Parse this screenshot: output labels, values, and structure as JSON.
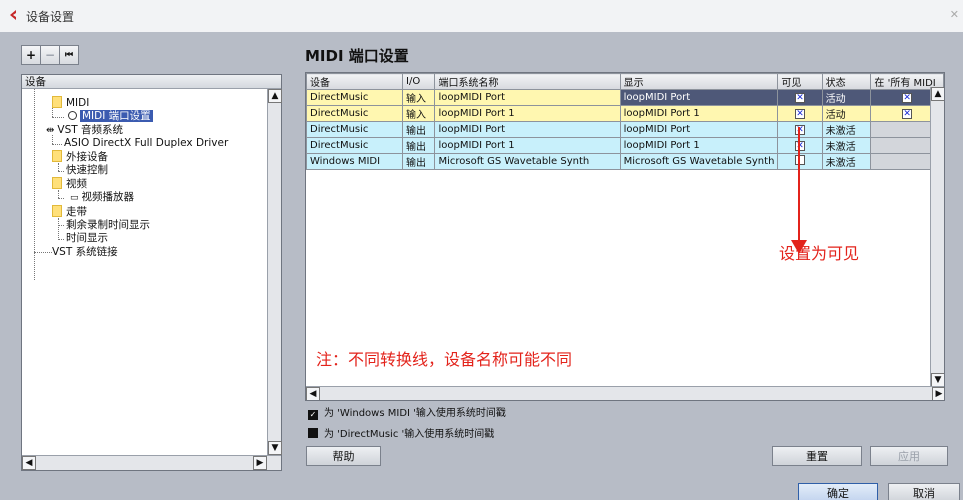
{
  "window": {
    "title": "设备设置"
  },
  "left_panel": {
    "toolbar": {
      "add": "+",
      "remove": "−",
      "reset": "⏮"
    },
    "tree_header": "设备",
    "tree_items": {
      "midi": "MIDI",
      "midi_port": "MIDI 端口设置",
      "vst_audio": "VST 音频系统",
      "asio": "ASIO DirectX Full Duplex Driver",
      "ext_devices": "外接设备",
      "quick_control": "快速控制",
      "video": "视频",
      "video_player": "视频播放器",
      "transport": "走带",
      "remaining_time": "剩余录制时间显示",
      "time_display": "时间显示",
      "vst_link": "VST 系统链接"
    }
  },
  "right_panel": {
    "title": "MIDI 端口设置",
    "columns": [
      "设备",
      "I/O",
      "端口系统名称",
      "显示",
      "可见",
      "状态",
      "在 '所有 MIDI"
    ],
    "rows": [
      {
        "device": "DirectMusic",
        "io": "输入",
        "port": "loopMIDI Port",
        "display": "loopMIDI Port",
        "visible": "x",
        "status": "活动",
        "all": "x"
      },
      {
        "device": "DirectMusic",
        "io": "输入",
        "port": "loopMIDI Port 1",
        "display": "loopMIDI Port 1",
        "visible": "x",
        "status": "活动",
        "all": "x"
      },
      {
        "device": "DirectMusic",
        "io": "输出",
        "port": "loopMIDI Port",
        "display": "loopMIDI Port",
        "visible": "x",
        "status": "未激活",
        "all": ""
      },
      {
        "device": "DirectMusic",
        "io": "输出",
        "port": "loopMIDI Port 1",
        "display": "loopMIDI Port 1",
        "visible": "x",
        "status": "未激活",
        "all": ""
      },
      {
        "device": "Windows MIDI",
        "io": "输出",
        "port": "Microsoft GS Wavetable Synth",
        "display": "Microsoft GS Wavetable Synth",
        "visible": "",
        "status": "未激活",
        "all": ""
      }
    ],
    "annotation_visible": "设置为可见",
    "annotation_note": "注：不同转换线，设备名称可能不同",
    "checkbox_windows": "为 'Windows MIDI '输入使用系统时间戳",
    "checkbox_directmusic": "为 'DirectMusic '输入使用系统时间戳",
    "help_button": "帮助",
    "reset_button": "重置",
    "apply_button": "应用"
  },
  "footer": {
    "ok_button": "确定",
    "cancel_button": "取消"
  },
  "colors": {
    "input_row": "#fff7b0",
    "output_row": "#c8f0fb",
    "annotation": "#e3231b",
    "selection": "#4e5878"
  }
}
